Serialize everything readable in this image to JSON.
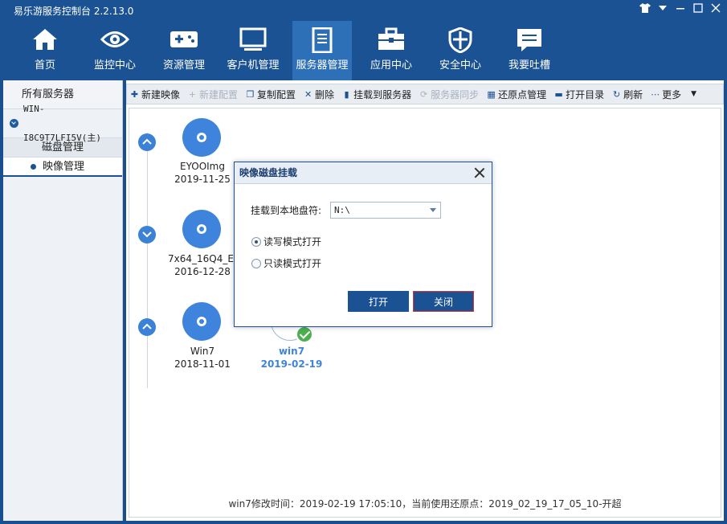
{
  "app": {
    "title": "易乐游服务控制台 2.2.13.0"
  },
  "nav": [
    {
      "label": "首页",
      "icon": "home-icon"
    },
    {
      "label": "监控中心",
      "icon": "eye-icon"
    },
    {
      "label": "资源管理",
      "icon": "gamepad-icon"
    },
    {
      "label": "客户机管理",
      "icon": "monitor-icon"
    },
    {
      "label": "服务器管理",
      "icon": "server-icon"
    },
    {
      "label": "应用中心",
      "icon": "toolbox-icon"
    },
    {
      "label": "安全中心",
      "icon": "shield-icon"
    },
    {
      "label": "我要吐槽",
      "icon": "chat-icon"
    }
  ],
  "nav_active": "服务器管理",
  "sidebar": {
    "header": "所有服务器",
    "server": "WIN-I8C9T7LFI5V(主)",
    "category": "磁盘管理",
    "item": "映像管理"
  },
  "toolbar": {
    "new_image": "新建映像",
    "new_config": "新建配置",
    "copy_config": "复制配置",
    "delete": "删除",
    "mount_server": "挂载到服务器",
    "server_sync": "服务器同步",
    "restore_point": "还原点管理",
    "open_dir": "打开目录",
    "refresh": "刷新",
    "more": "更多"
  },
  "images": [
    {
      "name": "EYOOImg",
      "date": "2019-11-25"
    },
    {
      "name": "7x64_16Q4_E\\",
      "date": "2016-12-28"
    },
    {
      "name": "Win7",
      "date": "2018-11-01"
    }
  ],
  "restore_point": {
    "name": "win7",
    "date": "2019-02-19"
  },
  "status": "win7修改时间：2019-02-19 17:05:10，当前使用还原点：2019_02_19_17_05_10-开超",
  "dialog": {
    "title": "映像磁盘挂载",
    "drive_label": "挂载到本地盘符:",
    "drive_value": "N:\\",
    "option_rw": "读写模式打开",
    "option_ro": "只读模式打开",
    "open_button": "打开",
    "close_button": "关闭"
  }
}
